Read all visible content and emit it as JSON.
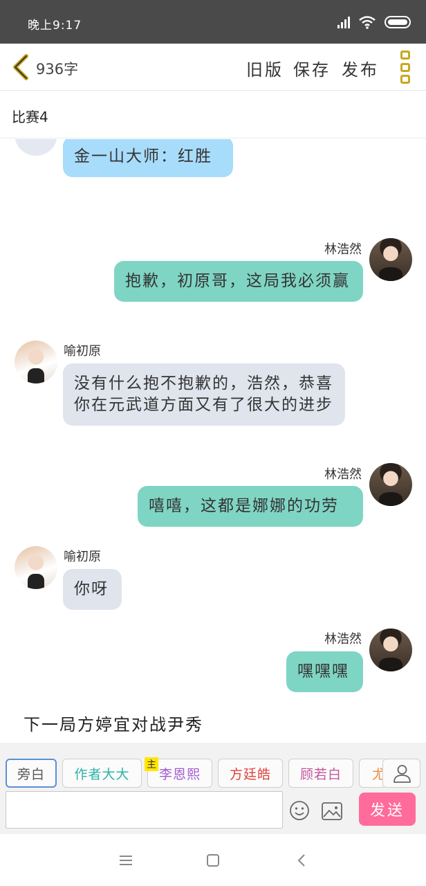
{
  "status_bar": {
    "time": "晚上9:17"
  },
  "header": {
    "word_count": "936字",
    "old_version": "旧版",
    "save": "保存",
    "publish": "发布"
  },
  "chapter_title": "比赛4",
  "messages": [
    {
      "speaker": "",
      "text": "金一山大师：红胜",
      "side": "left",
      "color": "blue"
    },
    {
      "speaker": "林浩然",
      "text": "抱歉，初原哥，这局我必须赢",
      "side": "right",
      "color": "green"
    },
    {
      "speaker": "喻初原",
      "text": "没有什么抱不抱歉的，浩然，恭喜你在元武道方面又有了很大的进步",
      "side": "left",
      "color": "gray"
    },
    {
      "speaker": "林浩然",
      "text": "嘻嘻，这都是娜娜的功劳",
      "side": "right",
      "color": "green"
    },
    {
      "speaker": "喻初原",
      "text": "你呀",
      "side": "left",
      "color": "gray"
    },
    {
      "speaker": "林浩然",
      "text": "嘿嘿嘿",
      "side": "right",
      "color": "green"
    }
  ],
  "narration": "下一局方婷宜对战尹秀",
  "role_tabs": [
    {
      "label": "旁白",
      "color": "#555555"
    },
    {
      "label": "作者大大",
      "color": "#2ab3a6"
    },
    {
      "label": "李恩熙",
      "color": "#a25ccf"
    },
    {
      "label": "方廷皓",
      "color": "#e0413a"
    },
    {
      "label": "顾若白",
      "color": "#c2579c"
    },
    {
      "label": "尤",
      "color": "#f08a3c"
    }
  ],
  "main_badge": "主",
  "input": {
    "value": "",
    "placeholder": ""
  },
  "send_label": "发送",
  "colors": {
    "accent_send": "#ff6b9a",
    "bubble_green": "#7fd5c4",
    "bubble_gray": "#dfe4ed",
    "bubble_blue": "#a8dcfb",
    "icon_gold": "#c8a820"
  }
}
